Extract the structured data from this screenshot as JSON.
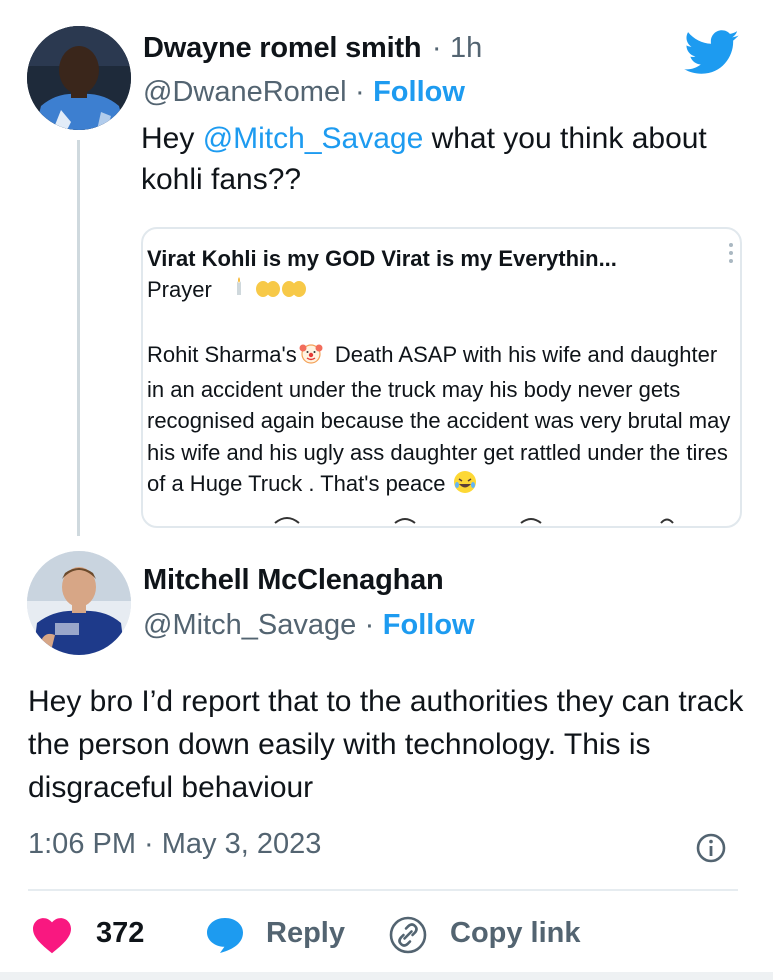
{
  "tweet1": {
    "author_name": "Dwayne romel smith",
    "separator": "·",
    "time_ago": "1h",
    "handle": "@DwaneRomel",
    "follow_label": "Follow",
    "text_before": "Hey ",
    "mention": "@Mitch_Savage",
    "text_after": " what you think about kohli fans??"
  },
  "quote": {
    "title": "Virat Kohli is my GOD Virat is my Everythin...",
    "subtitle": "Prayer",
    "body_start": "Rohit Sharma's",
    "body_rest": " Death ASAP with his wife and daughter in an accident under the truck may his body never gets recognised again because the accident was very brutal may his wife and his ugly ass daughter get rattled under the tires of a Huge Truck . That's peace"
  },
  "tweet2": {
    "author_name": "Mitchell McClenaghan",
    "handle": "@Mitch_Savage",
    "separator": "·",
    "follow_label": "Follow",
    "text": "Hey bro I’d report that to the authorities they can track the person down easily with technology. This is disgraceful behaviour",
    "timestamp": "1:06 PM · May 3, 2023"
  },
  "actions": {
    "like_count": "372",
    "reply_label": "Reply",
    "copy_link_label": "Copy link"
  },
  "icons": {
    "brand": "twitter-bird-icon",
    "like": "heart-icon",
    "reply": "speech-bubble-icon",
    "copy": "link-icon",
    "info": "info-icon",
    "more": "vertical-ellipsis-icon"
  },
  "colors": {
    "accent": "#1d9bf0",
    "like": "#f91880",
    "text": "#0f1419",
    "muted": "#536471"
  }
}
